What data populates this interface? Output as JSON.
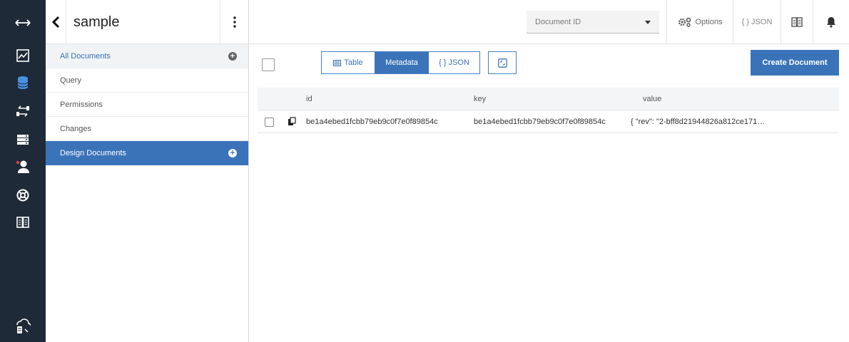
{
  "sidebar": {
    "db_name": "sample",
    "items": [
      {
        "label": "All Documents",
        "has_plus": true
      },
      {
        "label": "Query"
      },
      {
        "label": "Permissions"
      },
      {
        "label": "Changes"
      },
      {
        "label": "Design Documents",
        "has_plus": true
      }
    ]
  },
  "topbar": {
    "doc_select": "Document ID",
    "options_label": "Options",
    "json_label": "{ } JSON"
  },
  "toolbar": {
    "table_label": "Table",
    "metadata_label": "Metadata",
    "json_label": "{ } JSON",
    "selected_view": "Metadata",
    "create_label": "Create Document"
  },
  "table": {
    "columns": [
      "id",
      "key",
      "value"
    ],
    "rows": [
      {
        "id": "be1a4ebed1fcbb79eb9c0f7e0f89854c",
        "key": "be1a4ebed1fcbb79eb9c0f7e0f89854c",
        "value": "{ \"rev\": \"2-bff8d21944826a812ce171…"
      }
    ]
  },
  "colors": {
    "rail_bg": "#1f2a38",
    "accent": "#3b73b9",
    "active_rail_icon": "#4a90e2"
  },
  "icons": {
    "rail": [
      "collapse-arrows-icon",
      "dashboard-icon",
      "databases-icon",
      "replication-icon",
      "active-tasks-icon",
      "account-icon",
      "support-icon",
      "docs-book-icon",
      "cloud-db-icon"
    ]
  }
}
